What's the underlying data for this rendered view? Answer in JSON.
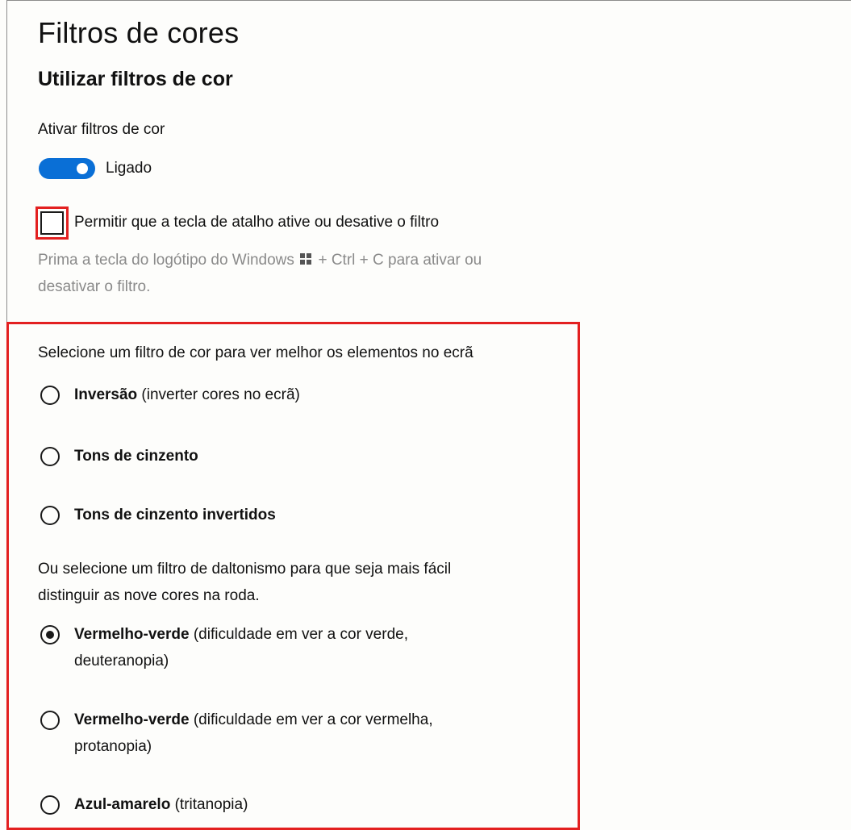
{
  "page": {
    "title": "Filtros de cores",
    "subtitle": "Utilizar filtros de cor"
  },
  "toggle_section": {
    "label": "Ativar filtros de cor",
    "state_text": "Ligado",
    "is_on": true,
    "accent_color": "#0a6fd6"
  },
  "shortcut": {
    "checkbox_label": "Permitir que a tecla de atalho ative ou desative o filtro",
    "checked": false,
    "help_before_icon": "Prima a tecla do logótipo do Windows",
    "help_icon": "windows-logo-icon",
    "help_after_icon": "+ Ctrl + C para ativar ou",
    "help_line2": "desativar o filtro."
  },
  "filters": {
    "prompt": "Selecione um filtro de cor para ver melhor os elementos no ecrã",
    "options": [
      {
        "bold": "Inversão",
        "rest": " (inverter cores no ecrã)",
        "selected": false
      },
      {
        "bold": "Tons de cinzento",
        "rest": "",
        "selected": false
      },
      {
        "bold": "Tons de cinzento invertidos",
        "rest": "",
        "selected": false
      }
    ]
  },
  "colorblind": {
    "prompt_line1": "Ou selecione um filtro de daltonismo para que seja mais fácil",
    "prompt_line2": "distinguir as nove cores na roda.",
    "options": [
      {
        "bold": "Vermelho-verde",
        "rest": " (dificuldade em ver a cor verde,",
        "rest2": "deuteranopia)",
        "selected": true
      },
      {
        "bold": "Vermelho-verde",
        "rest": " (dificuldade em ver a cor vermelha,",
        "rest2": "protanopia)",
        "selected": false
      },
      {
        "bold": "Azul-amarelo",
        "rest": " (tritanopia)",
        "rest2": "",
        "selected": false
      }
    ]
  },
  "annotations": {
    "highlight_color": "#e32020"
  }
}
